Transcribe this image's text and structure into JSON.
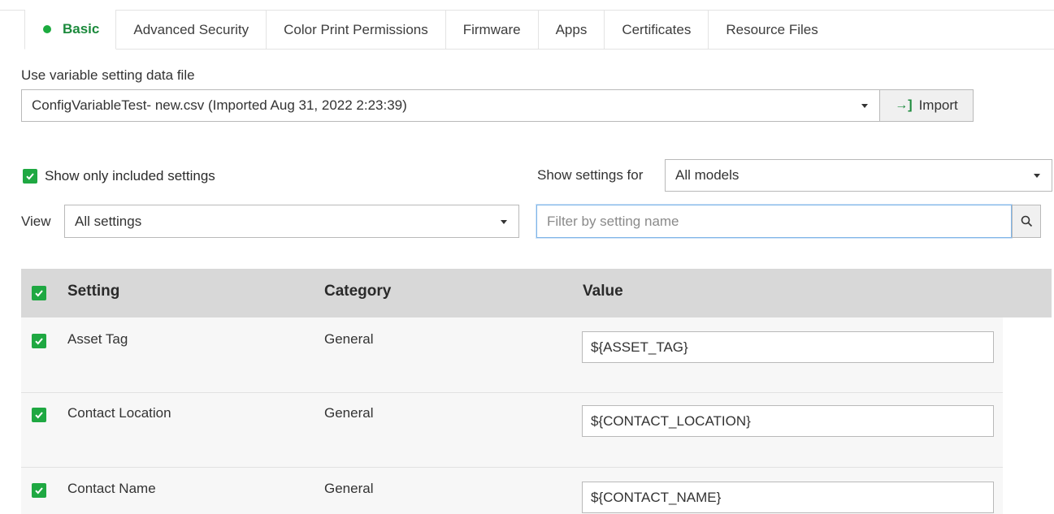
{
  "tabs": [
    {
      "label": "Basic",
      "active": true
    },
    {
      "label": "Advanced Security"
    },
    {
      "label": "Color Print Permissions"
    },
    {
      "label": "Firmware"
    },
    {
      "label": "Apps"
    },
    {
      "label": "Certificates"
    },
    {
      "label": "Resource Files"
    }
  ],
  "variable_file": {
    "label": "Use variable setting data file",
    "selected": "ConfigVariableTest- new.csv (Imported Aug 31, 2022 2:23:39)",
    "import_label": "Import"
  },
  "filters": {
    "show_only_included_label": "Show only included settings",
    "show_only_included_checked": true,
    "show_settings_for_label": "Show settings for",
    "show_settings_for_value": "All models",
    "view_label": "View",
    "view_value": "All settings",
    "filter_placeholder": "Filter by setting name"
  },
  "table": {
    "headers": {
      "setting": "Setting",
      "category": "Category",
      "value": "Value"
    },
    "rows": [
      {
        "setting": "Asset Tag",
        "category": "General",
        "value": "${ASSET_TAG}",
        "checked": true
      },
      {
        "setting": "Contact Location",
        "category": "General",
        "value": "${CONTACT_LOCATION}",
        "checked": true
      },
      {
        "setting": "Contact Name",
        "category": "General",
        "value": "${CONTACT_NAME}",
        "checked": true
      }
    ]
  },
  "colors": {
    "accent": "#1fa842",
    "active_tab": "#1c8a3c",
    "header_bg": "#d8d8d8"
  }
}
